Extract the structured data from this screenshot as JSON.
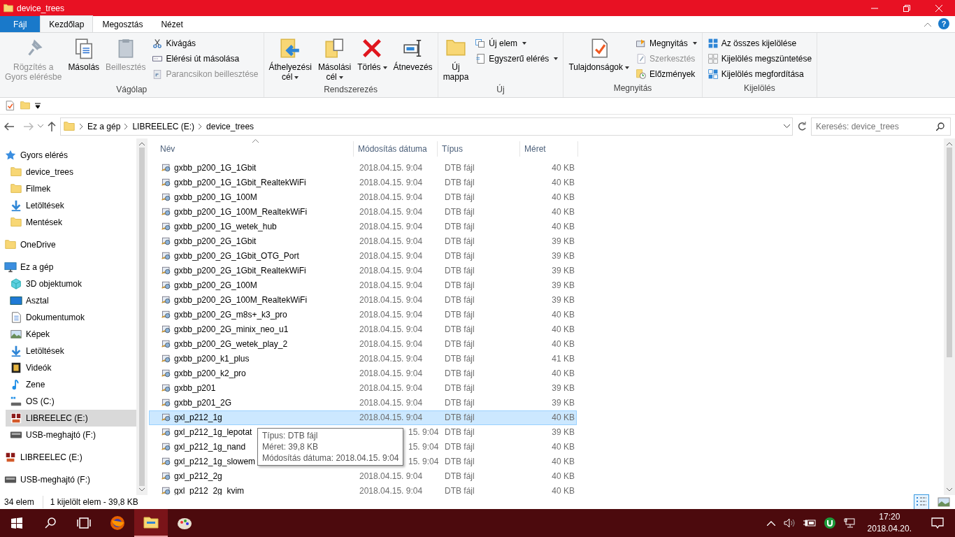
{
  "window": {
    "title": "device_trees",
    "help": "?"
  },
  "tabs": [
    {
      "label": "Fájl",
      "kind": "file",
      "selected": false
    },
    {
      "label": "Kezdőlap",
      "kind": "tab",
      "selected": true
    },
    {
      "label": "Megosztás",
      "kind": "tab",
      "selected": false
    },
    {
      "label": "Nézet",
      "kind": "tab",
      "selected": false
    }
  ],
  "ribbon": [
    {
      "label": "Vágólap",
      "large": [
        {
          "label": "Rögzítés a\nGyors elérésbe",
          "kind": "pin",
          "disabled": true,
          "dropdown": false
        },
        {
          "label": "Másolás",
          "kind": "copy",
          "disabled": false,
          "dropdown": false
        },
        {
          "label": "Beillesztés",
          "kind": "clipboard",
          "disabled": true,
          "dropdown": false
        }
      ],
      "small": [
        {
          "label": "Kivágás",
          "kind": "scissors",
          "disabled": false,
          "dropdown": false
        },
        {
          "label": "Elérési út másolása",
          "kind": "path",
          "disabled": false,
          "dropdown": false
        },
        {
          "label": "Parancsikon beillesztése",
          "kind": "shortcut",
          "disabled": true,
          "dropdown": false
        }
      ]
    },
    {
      "label": "Rendszerezés",
      "large": [
        {
          "label": "Áthelyezési\ncél",
          "kind": "move",
          "disabled": false,
          "dropdown": true
        },
        {
          "label": "Másolási\ncél",
          "kind": "copyto",
          "disabled": false,
          "dropdown": true
        },
        {
          "label": "Törlés",
          "kind": "delete",
          "disabled": false,
          "dropdown": true
        },
        {
          "label": "Átnevezés",
          "kind": "rename",
          "disabled": false,
          "dropdown": false
        }
      ]
    },
    {
      "label": "Új",
      "large": [
        {
          "label": "Új\nmappa",
          "kind": "folder",
          "disabled": false,
          "dropdown": false
        }
      ],
      "small": [
        {
          "label": "Új elem",
          "kind": "newitem",
          "disabled": false,
          "dropdown": true
        },
        {
          "label": "Egyszerű elérés",
          "kind": "easy",
          "disabled": false,
          "dropdown": true
        }
      ]
    },
    {
      "label": "Megnyitás",
      "large": [
        {
          "label": "Tulajdonságok",
          "kind": "properties",
          "disabled": false,
          "dropdown": true
        }
      ],
      "small": [
        {
          "label": "Megnyitás",
          "kind": "open",
          "disabled": false,
          "dropdown": true
        },
        {
          "label": "Szerkesztés",
          "kind": "edit",
          "disabled": true,
          "dropdown": false
        },
        {
          "label": "Előzmények",
          "kind": "history",
          "disabled": false,
          "dropdown": false
        }
      ]
    },
    {
      "label": "Kijelölés",
      "small": [
        {
          "label": "Az összes kijelölése",
          "kind": "selectall",
          "disabled": false,
          "dropdown": false
        },
        {
          "label": "Kijelölés megszüntetése",
          "kind": "selectnone",
          "disabled": false,
          "dropdown": false
        },
        {
          "label": "Kijelölés megfordítása",
          "kind": "invert",
          "disabled": false,
          "dropdown": false
        }
      ]
    }
  ],
  "address": {
    "crumbs": [
      "Ez a gép",
      "LIBREELEC (E:)",
      "device_trees"
    ]
  },
  "search": {
    "placeholder": "Keresés: device_trees"
  },
  "nav": [
    {
      "label": "Gyors elérés",
      "kind": "star",
      "selected": false,
      "children": [
        {
          "label": "device_trees",
          "kind": "folder",
          "selected": false
        },
        {
          "label": "Filmek",
          "kind": "folder",
          "selected": false
        },
        {
          "label": "Letöltések",
          "kind": "download",
          "selected": false
        },
        {
          "label": "Mentések",
          "kind": "folder",
          "selected": false
        }
      ]
    },
    {
      "label": "OneDrive",
      "kind": "folder",
      "selected": false
    },
    {
      "label": "Ez a gép",
      "kind": "monitor",
      "selected": false,
      "children": [
        {
          "label": "3D objektumok",
          "kind": "cube",
          "selected": false
        },
        {
          "label": "Asztal",
          "kind": "desktop",
          "selected": false
        },
        {
          "label": "Dokumentumok",
          "kind": "document",
          "selected": false
        },
        {
          "label": "Képek",
          "kind": "picture",
          "selected": false
        },
        {
          "label": "Letöltések",
          "kind": "download",
          "selected": false
        },
        {
          "label": "Videók",
          "kind": "film",
          "selected": false
        },
        {
          "label": "Zene",
          "kind": "music",
          "selected": false
        },
        {
          "label": "OS (C:)",
          "kind": "osdrive",
          "selected": false
        },
        {
          "label": "LIBREELEC (E:)",
          "kind": "sd",
          "selected": true
        },
        {
          "label": "USB-meghajtó (F:)",
          "kind": "drive",
          "selected": false
        }
      ]
    },
    {
      "label": "LIBREELEC (E:)",
      "kind": "sd",
      "selected": false
    },
    {
      "label": "USB-meghajtó (F:)",
      "kind": "drive",
      "selected": false
    }
  ],
  "columns": [
    "Név",
    "Módosítás dátuma",
    "Típus",
    "Méret"
  ],
  "files": [
    {
      "name": "gxbb_p200_1G_1Gbit",
      "date": "2018.04.15. 9:04",
      "type": "DTB fájl",
      "size": "40 KB",
      "selected": false,
      "covered": false
    },
    {
      "name": "gxbb_p200_1G_1Gbit_RealtekWiFi",
      "date": "2018.04.15. 9:04",
      "type": "DTB fájl",
      "size": "40 KB",
      "selected": false,
      "covered": false
    },
    {
      "name": "gxbb_p200_1G_100M",
      "date": "2018.04.15. 9:04",
      "type": "DTB fájl",
      "size": "40 KB",
      "selected": false,
      "covered": false
    },
    {
      "name": "gxbb_p200_1G_100M_RealtekWiFi",
      "date": "2018.04.15. 9:04",
      "type": "DTB fájl",
      "size": "40 KB",
      "selected": false,
      "covered": false
    },
    {
      "name": "gxbb_p200_1G_wetek_hub",
      "date": "2018.04.15. 9:04",
      "type": "DTB fájl",
      "size": "40 KB",
      "selected": false,
      "covered": false
    },
    {
      "name": "gxbb_p200_2G_1Gbit",
      "date": "2018.04.15. 9:04",
      "type": "DTB fájl",
      "size": "39 KB",
      "selected": false,
      "covered": false
    },
    {
      "name": "gxbb_p200_2G_1Gbit_OTG_Port",
      "date": "2018.04.15. 9:04",
      "type": "DTB fájl",
      "size": "39 KB",
      "selected": false,
      "covered": false
    },
    {
      "name": "gxbb_p200_2G_1Gbit_RealtekWiFi",
      "date": "2018.04.15. 9:04",
      "type": "DTB fájl",
      "size": "39 KB",
      "selected": false,
      "covered": false
    },
    {
      "name": "gxbb_p200_2G_100M",
      "date": "2018.04.15. 9:04",
      "type": "DTB fájl",
      "size": "39 KB",
      "selected": false,
      "covered": false
    },
    {
      "name": "gxbb_p200_2G_100M_RealtekWiFi",
      "date": "2018.04.15. 9:04",
      "type": "DTB fájl",
      "size": "39 KB",
      "selected": false,
      "covered": false
    },
    {
      "name": "gxbb_p200_2G_m8s+_k3_pro",
      "date": "2018.04.15. 9:04",
      "type": "DTB fájl",
      "size": "40 KB",
      "selected": false,
      "covered": false
    },
    {
      "name": "gxbb_p200_2G_minix_neo_u1",
      "date": "2018.04.15. 9:04",
      "type": "DTB fájl",
      "size": "40 KB",
      "selected": false,
      "covered": false
    },
    {
      "name": "gxbb_p200_2G_wetek_play_2",
      "date": "2018.04.15. 9:04",
      "type": "DTB fájl",
      "size": "40 KB",
      "selected": false,
      "covered": false
    },
    {
      "name": "gxbb_p200_k1_plus",
      "date": "2018.04.15. 9:04",
      "type": "DTB fájl",
      "size": "41 KB",
      "selected": false,
      "covered": false
    },
    {
      "name": "gxbb_p200_k2_pro",
      "date": "2018.04.15. 9:04",
      "type": "DTB fájl",
      "size": "40 KB",
      "selected": false,
      "covered": false
    },
    {
      "name": "gxbb_p201",
      "date": "2018.04.15. 9:04",
      "type": "DTB fájl",
      "size": "39 KB",
      "selected": false,
      "covered": false
    },
    {
      "name": "gxbb_p201_2G",
      "date": "2018.04.15. 9:04",
      "type": "DTB fájl",
      "size": "39 KB",
      "selected": false,
      "covered": false
    },
    {
      "name": "gxl_p212_1g",
      "date": "2018.04.15. 9:04",
      "type": "DTB fájl",
      "size": "40 KB",
      "selected": true,
      "covered": false
    },
    {
      "name": "gxl_p212_1g_lepotat",
      "date": "15. 9:04",
      "type": "DTB fájl",
      "size": "39 KB",
      "selected": false,
      "covered": true
    },
    {
      "name": "gxl_p212_1g_nand",
      "date": "15. 9:04",
      "type": "DTB fájl",
      "size": "40 KB",
      "selected": false,
      "covered": true
    },
    {
      "name": "gxl_p212_1g_slowem",
      "date": "15. 9:04",
      "type": "DTB fájl",
      "size": "40 KB",
      "selected": false,
      "covered": true
    },
    {
      "name": "gxl_p212_2g",
      "date": "2018.04.15. 9:04",
      "type": "DTB fájl",
      "size": "40 KB",
      "selected": false,
      "covered": false
    },
    {
      "name": "gxl_p212_2g_kvim",
      "date": "2018.04.15. 9:04",
      "type": "DTB fájl",
      "size": "40 KB",
      "selected": false,
      "covered": false
    }
  ],
  "tooltip": [
    "Típus: DTB fájl",
    "Méret: 39,8 KB",
    "Módosítás dátuma: 2018.04.15. 9:04"
  ],
  "status_bar": {
    "count": "34 elem",
    "selection": "1 kijelölt elem - 39,8 KB",
    "views": [
      {
        "kind": "details",
        "selected": true
      },
      {
        "kind": "thumbnails",
        "selected": false
      }
    ]
  },
  "taskbar": {
    "apps": [
      {
        "kind": "firefox",
        "selected": false
      },
      {
        "kind": "explorer",
        "selected": true
      },
      {
        "kind": "paint",
        "selected": false
      }
    ],
    "time": "17:20",
    "date": "2018.04.20."
  }
}
